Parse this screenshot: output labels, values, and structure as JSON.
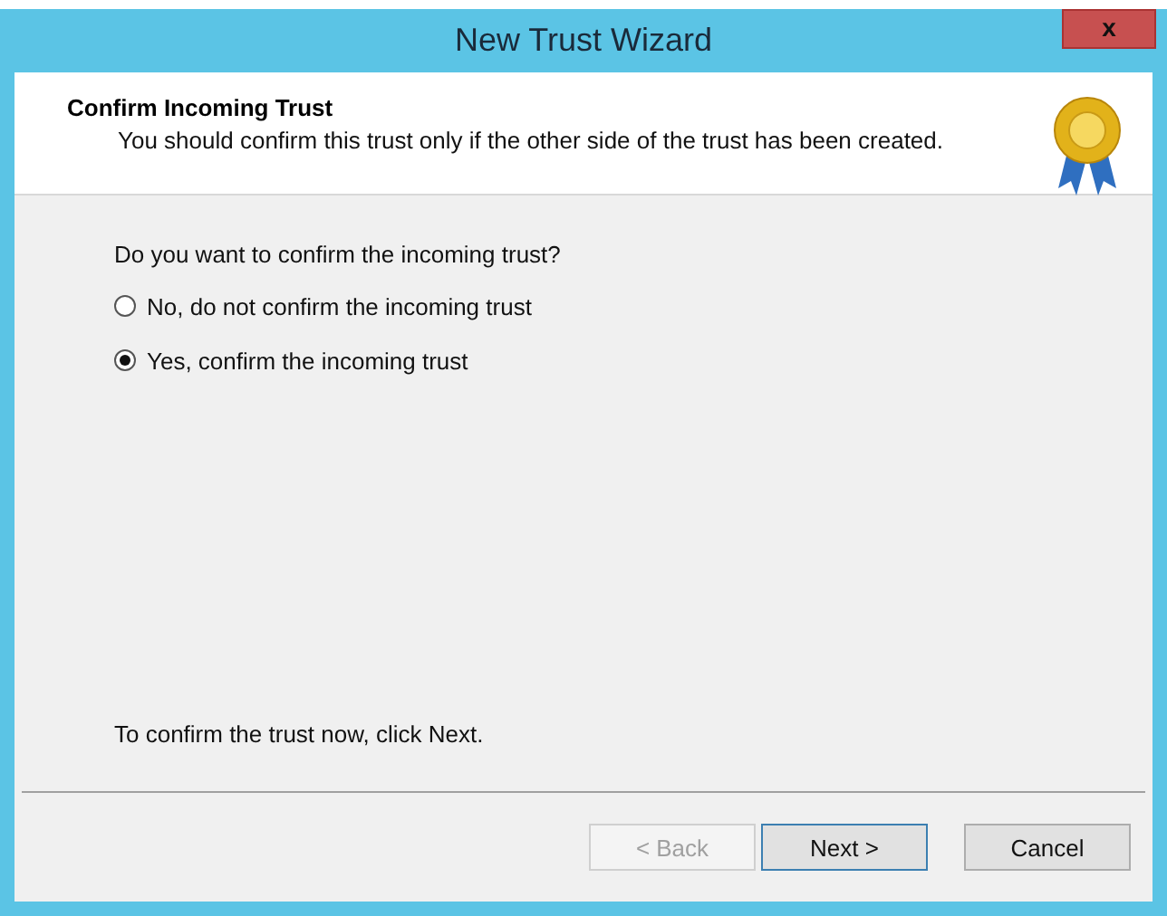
{
  "window": {
    "title": "New Trust Wizard",
    "close": "x"
  },
  "header": {
    "title": "Confirm Incoming Trust",
    "subtitle": "You should confirm this trust only if the other side of the trust has been created."
  },
  "question": "Do you want to confirm the incoming trust?",
  "options": [
    {
      "label": "No, do not confirm the incoming trust",
      "selected": false
    },
    {
      "label": "Yes, confirm the incoming trust",
      "selected": true
    }
  ],
  "footer_note": "To confirm the trust now, click Next.",
  "buttons": [
    {
      "label": "< Back",
      "disabled": true,
      "default": false
    },
    {
      "label": "Next >",
      "disabled": false,
      "default": true
    },
    {
      "label": "Cancel",
      "disabled": false,
      "default": false
    }
  ]
}
